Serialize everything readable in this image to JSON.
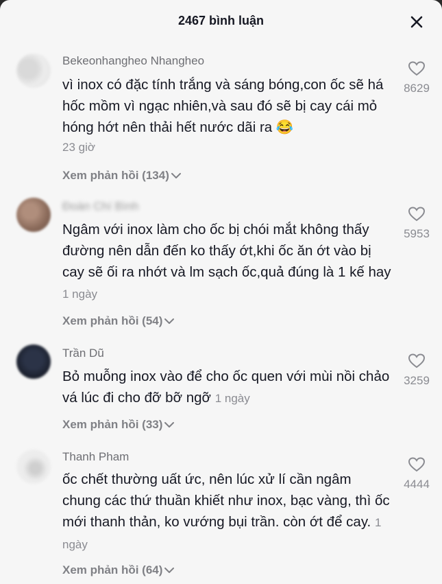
{
  "header": {
    "title": "2467 bình luận",
    "close_icon": "close-icon"
  },
  "comments": [
    {
      "username": "Bekeonhangheo Nhangheo",
      "text": "vì inox có đặc tính trắng và sáng bóng,con ốc sẽ há hốc mồm vì ngạc nhiên,và sau đó sẽ bị cay cái mỏ hóng hớt nên thải hết nước dãi ra 😂",
      "time": "23 giờ",
      "likes": "8629",
      "replies": "Xem phản hồi (134)"
    },
    {
      "username": "Đoàn Chí Bình",
      "text": "Ngâm với inox làm cho ốc bị chói mắt không thấy đường nên dẫn đến ko thấy ớt,khi ốc ăn ớt vào bị cay sẽ ối ra nhớt và lm sạch ốc,quả đúng là 1 kế hay",
      "time": "1 ngày",
      "likes": "5953",
      "replies": "Xem phản hồi (54)"
    },
    {
      "username": "Trần Dũ",
      "text": "Bỏ muỗng inox vào để cho ốc quen với mùi nồi chảo vá lúc đi cho đỡ bỡ ngỡ",
      "time": "1 ngày",
      "likes": "3259",
      "replies": "Xem phản hồi (33)"
    },
    {
      "username": "Thanh Pham",
      "text": "ốc chết thường uất ức, nên lúc xử lí cần ngâm chung các thứ thuần khiết như inox, bạc vàng, thì ốc mới thanh thản, ko vướng bụi trần. còn ớt để cay.",
      "time": "1 ngày",
      "likes": "4444",
      "replies": "Xem phản hồi (64)"
    }
  ],
  "colors": {
    "background": "#f6f6f6",
    "text": "#161823",
    "secondary": "#8a8b91"
  }
}
